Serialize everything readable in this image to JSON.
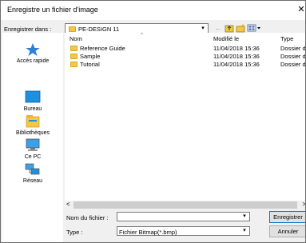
{
  "dialog": {
    "title": "Enregistre un fichier d'image",
    "close_glyph": "✕"
  },
  "toolbar": {
    "save_in_label": "Enregistrer dans :",
    "location": "PE-DESIGN 11",
    "icons": [
      "back-arrow-icon",
      "up-folder-icon",
      "new-folder-icon",
      "view-menu-icon"
    ]
  },
  "places": [
    {
      "label": "Accès rapide",
      "icon": "star-icon"
    },
    {
      "label": "Bureau",
      "icon": "desktop-icon"
    },
    {
      "label": "Bibliothèques",
      "icon": "libraries-icon"
    },
    {
      "label": "Ce PC",
      "icon": "computer-icon"
    },
    {
      "label": "Réseau",
      "icon": "network-icon"
    }
  ],
  "filelist": {
    "columns": [
      "Nom",
      "Modifié le",
      "Type"
    ],
    "rows": [
      {
        "name": "Reference Guide",
        "modified": "11/04/2018 15:36",
        "type": "Dossier d"
      },
      {
        "name": "Sample",
        "modified": "11/04/2018 15:36",
        "type": "Dossier d"
      },
      {
        "name": "Tutorial",
        "modified": "11/04/2018 15:36",
        "type": "Dossier d"
      }
    ]
  },
  "footer": {
    "filename_label": "Nom du fichier :",
    "filename_value": "",
    "type_label": "Type :",
    "type_value": "Fichier Bitmap(*.bmp)",
    "save_button": "Enregistrer",
    "cancel_button": "Annuler"
  },
  "colors": {
    "folder": "#f4c842",
    "accent": "#0078d7"
  }
}
